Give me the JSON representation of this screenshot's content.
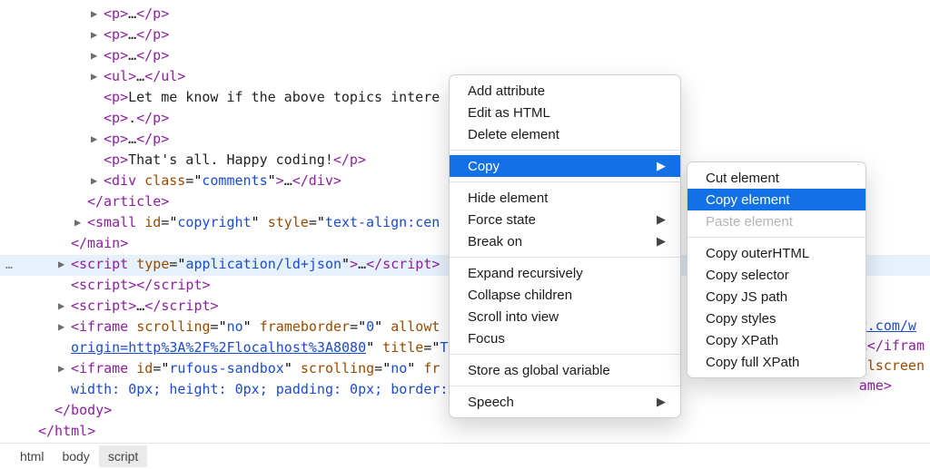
{
  "gutter": {
    "dots": "…"
  },
  "lines": {
    "l01": {
      "t1": "p",
      "e": "…",
      "t2": "/p"
    },
    "l02": {
      "t1": "p",
      "e": "…",
      "t2": "/p"
    },
    "l03": {
      "t1": "p",
      "e": "…",
      "t2": "/p"
    },
    "l04": {
      "t1": "ul",
      "e": "…",
      "t2": "/ul"
    },
    "l05": {
      "t1": "p",
      "txt": "Let me know if the above topics intere"
    },
    "l06": {
      "t1": "p",
      "txt": ".",
      "t2": "/p"
    },
    "l07": {
      "t1": "p",
      "e": "…",
      "t2": "/p"
    },
    "l08": {
      "t1": "p",
      "txt": "That's all. Happy coding!",
      "t2": "/p"
    },
    "l09": {
      "t1": "div",
      "a": "class",
      "v": "comments",
      "e": "…",
      "t2": "/div"
    },
    "l10": {
      "t1": "/article"
    },
    "l11": {
      "t1": "small",
      "a1": "id",
      "v1": "copyright",
      "a2": "style",
      "v2": "text-align:cen"
    },
    "l12": {
      "t1": "/main"
    },
    "l13": {
      "t1": "script",
      "a": "type",
      "v": "application/ld+json",
      "e": "…",
      "t2": "/script"
    },
    "l14": {
      "t1": "script",
      "t2": "/script"
    },
    "l15": {
      "t1": "script",
      "e": "…",
      "t2": "/script"
    },
    "l16": {
      "t1": "iframe",
      "a1": "scrolling",
      "v1": "no",
      "a2": "frameborder",
      "v2": "0",
      "a3": "allowt",
      "link": "origin=http%3A%2F%2Flocalhost%3A8080",
      "a4": "title",
      "v4": "T",
      "tail_link": "r.com/w",
      "tail_e": "…",
      "tail_t2": "/ifram"
    },
    "l17": {
      "t1": "iframe",
      "a1": "id",
      "v1": "rufous-sandbox",
      "a2": "scrolling",
      "v2": "no",
      "a3": "fr",
      "txt2": "width: 0px; height: 0px; padding: 0px; border:",
      "tail_a": "llscreen",
      "tail_t2": "ame"
    },
    "l18": {
      "t1": "/body"
    },
    "l19": {
      "t1": "/html"
    }
  },
  "menu": {
    "main": {
      "add_attribute": "Add attribute",
      "edit_as_html": "Edit as HTML",
      "delete_element": "Delete element",
      "copy": "Copy",
      "hide_element": "Hide element",
      "force_state": "Force state",
      "break_on": "Break on",
      "expand_recursively": "Expand recursively",
      "collapse_children": "Collapse children",
      "scroll_into_view": "Scroll into view",
      "focus": "Focus",
      "store_as_global": "Store as global variable",
      "speech": "Speech"
    },
    "sub": {
      "cut_element": "Cut element",
      "copy_element": "Copy element",
      "paste_element": "Paste element",
      "copy_outerhtml": "Copy outerHTML",
      "copy_selector": "Copy selector",
      "copy_js_path": "Copy JS path",
      "copy_styles": "Copy styles",
      "copy_xpath": "Copy XPath",
      "copy_full_xpath": "Copy full XPath"
    }
  },
  "crumbs": {
    "a": "html",
    "b": "body",
    "c": "script"
  }
}
